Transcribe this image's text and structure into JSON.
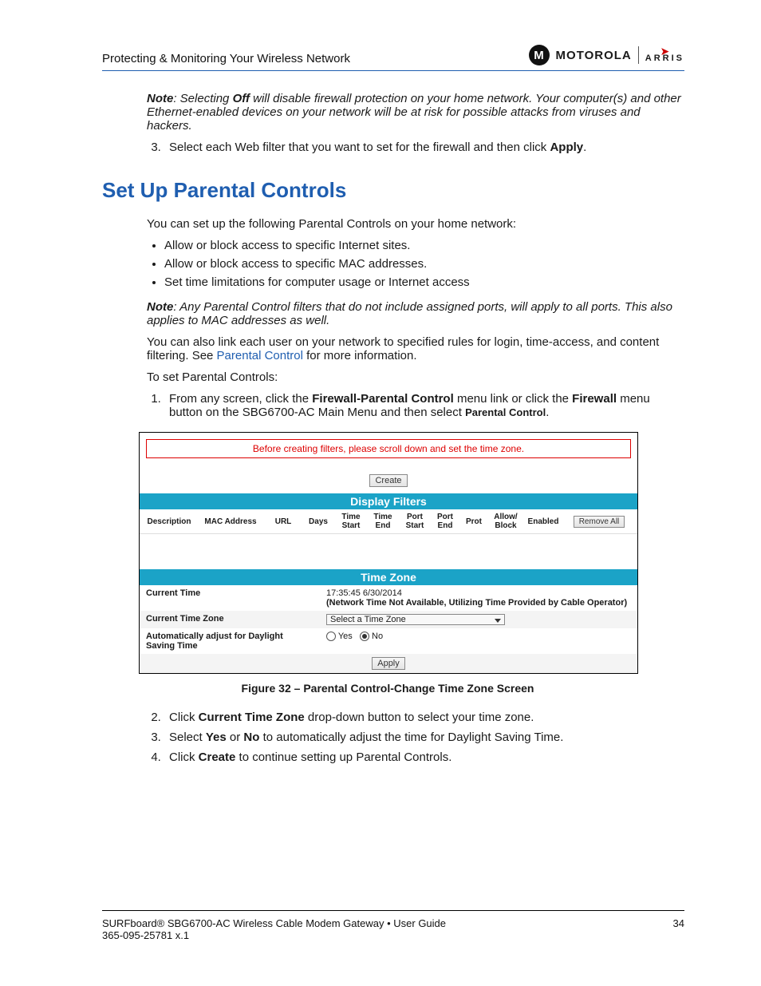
{
  "header": {
    "breadcrumb": "Protecting & Monitoring Your Wireless Network",
    "brand1": "MOTOROLA",
    "brand2": "ARRIS"
  },
  "intro": {
    "note_label": "Note",
    "note_text": ": Selecting ",
    "note_bold": "Off",
    "note_tail": " will disable firewall protection on your home network. Your computer(s) and other Ethernet-enabled devices on your network will be at risk for possible attacks from viruses and hackers.",
    "step3_a": "Select each Web filter that you want to set for the firewall and then click ",
    "step3_b": "Apply",
    "step3_c": "."
  },
  "section_title": "Set Up Parental Controls",
  "p1": "You can set up the following Parental Controls on your home network:",
  "bullets": [
    "Allow or block access to specific Internet sites.",
    "Allow or block access to specific MAC addresses.",
    "Set time limitations for computer usage or Internet access"
  ],
  "note2_label": "Note",
  "note2_text": ": Any Parental Control filters that do not include assigned ports, will apply to all ports. This also applies to MAC addresses as well.",
  "p2_a": "You can also link each user on your network to specified rules for login, time-access, and content filtering. See ",
  "p2_link": "Parental Control",
  "p2_b": " for more information.",
  "p3": "To set Parental Controls:",
  "step1_a": "From any screen, click the ",
  "step1_b": "Firewall-Parental Control",
  "step1_c": " menu link or click the ",
  "step1_d": "Firewall",
  "step1_e": " menu button on the SBG6700-AC Main Menu and then select ",
  "step1_f": "Parental Control",
  "step1_g": ".",
  "figure": {
    "red_banner": "Before creating filters, please scroll down and set the time zone.",
    "create": "Create",
    "display_filters": "Display Filters",
    "cols": {
      "desc": "Description",
      "mac": "MAC Address",
      "url": "URL",
      "days": "Days",
      "tstart": "Time Start",
      "tend": "Time End",
      "pstart": "Port Start",
      "pend": "Port End",
      "prot": "Prot",
      "ab": "Allow/ Block",
      "en": "Enabled",
      "remove": "Remove All"
    },
    "timezone_bar": "Time Zone",
    "tz": {
      "ct_label": "Current Time",
      "ct_value": "17:35:45 6/30/2014",
      "ct_note": "(Network Time Not Available, Utilizing Time Provided by Cable Operator)",
      "ctz_label": "Current Time Zone",
      "ctz_value": "Select a Time Zone",
      "dst_label": "Automatically adjust for Daylight Saving Time",
      "yes": "Yes",
      "no": "No",
      "apply": "Apply"
    }
  },
  "caption": "Figure 32 – Parental Control-Change Time Zone Screen",
  "steps_after": {
    "s2_a": "Click ",
    "s2_b": "Current Time Zone",
    "s2_c": " drop-down button to select your time zone.",
    "s3_a": "Select ",
    "s3_b": "Yes",
    "s3_c": " or ",
    "s3_d": "No",
    "s3_e": " to automatically adjust the time for Daylight Saving Time.",
    "s4_a": "Click ",
    "s4_b": "Create",
    "s4_c": " to continue setting up Parental Controls."
  },
  "footer": {
    "line1": "SURFboard® SBG6700-AC Wireless Cable Modem Gateway • User Guide",
    "page": "34",
    "line2": "365-095-25781 x.1"
  }
}
